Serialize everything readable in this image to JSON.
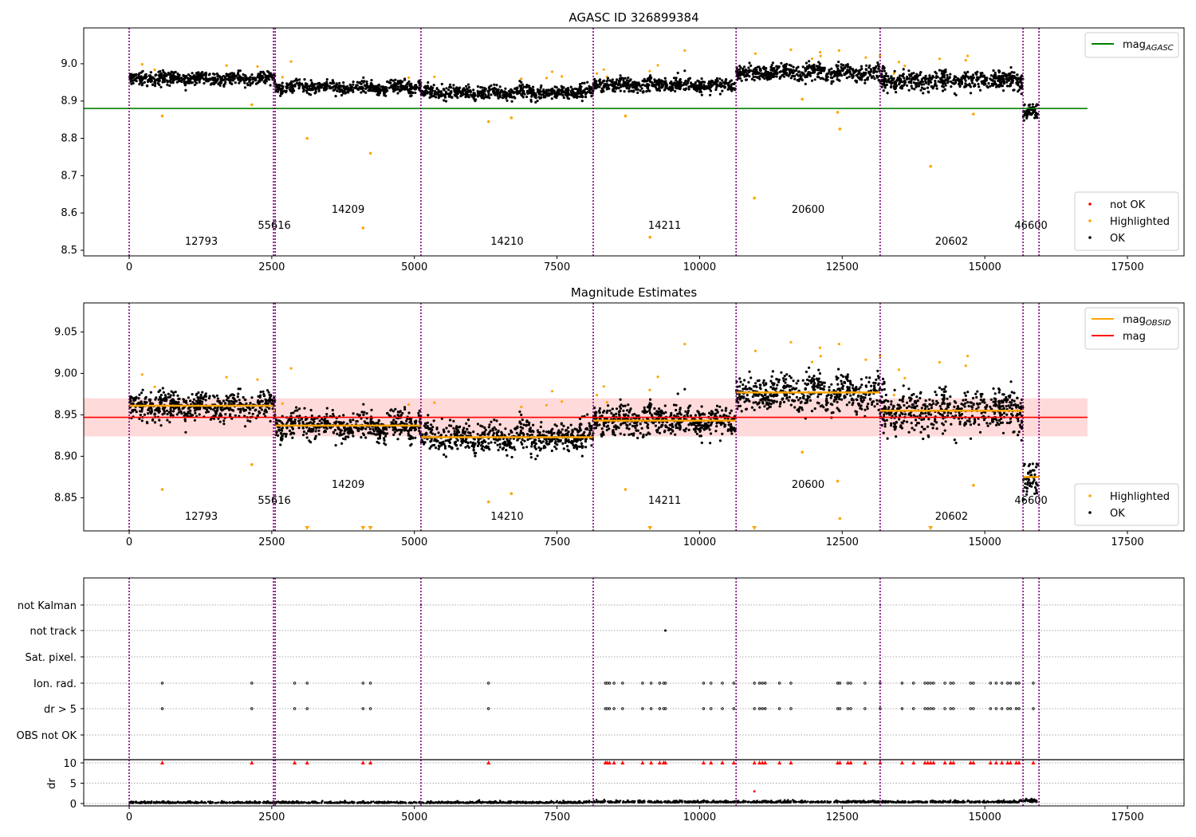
{
  "chart_data": [
    {
      "type": "scatter",
      "title": "AGASC ID 326899384",
      "xlim": [
        -800,
        18500
      ],
      "ylim": [
        8.485,
        9.096
      ],
      "xticks": [
        "0",
        "2500",
        "5000",
        "7500",
        "10000",
        "12500",
        "15000",
        "17500"
      ],
      "yticks": [
        "8.5",
        "8.6",
        "8.7",
        "8.8",
        "8.9",
        "9.0"
      ],
      "mag_agasc": 8.88,
      "legend_upper": {
        "position": "upper right",
        "entries": [
          {
            "label": "mag",
            "sub": "AGASC",
            "color": "#008000"
          }
        ]
      },
      "legend_lower": {
        "position": "lower right",
        "entries": [
          {
            "label": "not OK",
            "color": "#ff0000"
          },
          {
            "label": "Highlighted",
            "color": "#ffa500"
          },
          {
            "label": "OK",
            "color": "#000000"
          }
        ]
      },
      "highlighted": [
        [
          580,
          8.86
        ],
        [
          2150,
          8.89
        ],
        [
          3120,
          8.8
        ],
        [
          4230,
          8.76
        ],
        [
          4100,
          8.56
        ],
        [
          6300,
          8.845
        ],
        [
          6700,
          8.855
        ],
        [
          8700,
          8.86
        ],
        [
          9130,
          8.535
        ],
        [
          10960,
          8.64
        ],
        [
          11800,
          8.905
        ],
        [
          12420,
          8.87
        ],
        [
          12460,
          8.825
        ],
        [
          14050,
          8.725
        ],
        [
          14800,
          8.865
        ]
      ]
    },
    {
      "type": "scatter",
      "title": "Magnitude Estimates",
      "xlim": [
        -800,
        18500
      ],
      "ylim": [
        8.81,
        9.085
      ],
      "xticks": [
        "0",
        "2500",
        "5000",
        "7500",
        "10000",
        "12500",
        "15000",
        "17500"
      ],
      "yticks": [
        "8.85",
        "8.90",
        "8.95",
        "9.00",
        "9.05"
      ],
      "mag": 8.947,
      "mag_band": [
        8.924,
        8.97
      ],
      "legend_upper": {
        "position": "upper right",
        "entries": [
          {
            "label": "mag",
            "sub": "OBSID",
            "color": "#ffa500"
          },
          {
            "label": "mag",
            "color": "#ff0000"
          }
        ]
      },
      "legend_lower": {
        "position": "lower right",
        "entries": [
          {
            "label": "Highlighted",
            "color": "#ffa500"
          },
          {
            "label": "OK",
            "color": "#000000"
          }
        ]
      },
      "below_range": [
        3120,
        4100,
        4230,
        9130,
        10960,
        14050
      ]
    },
    {
      "type": "scatter",
      "title": "",
      "xlim": [
        -800,
        18500
      ],
      "xticks": [
        "0",
        "2500",
        "5000",
        "7500",
        "10000",
        "12500",
        "15000",
        "17500"
      ],
      "flag_labels": [
        "not Kalman",
        "not track",
        "Sat. pixel.",
        "Ion. rad.",
        "dr > 5",
        "OBS not OK"
      ],
      "ylabel": "dr",
      "dr_ticks": [
        "0",
        "5",
        "10"
      ],
      "ion_rad_times": [
        580,
        2150,
        2900,
        3120,
        4100,
        4230,
        6300,
        8350,
        8380,
        8420,
        8500,
        8650,
        9000,
        9150,
        9300,
        9370,
        9400,
        10070,
        10200,
        10400,
        10600,
        10960,
        11050,
        11100,
        11150,
        11400,
        11600,
        12420,
        12460,
        12600,
        12650,
        12900,
        13165,
        13550,
        13750,
        13950,
        14000,
        14050,
        14100,
        14300,
        14400,
        14450,
        14750,
        14800,
        15100,
        15200,
        15300,
        15400,
        15450,
        15550,
        15600,
        15850
      ],
      "not_track_times": [
        9400
      ],
      "not_kalman_times": [
        5115,
        13165,
        15670
      ]
    }
  ],
  "observations": [
    {
      "obsid": "12793",
      "start": 0,
      "end": 2530,
      "mean": 8.961,
      "std": 0.008,
      "row": 0
    },
    {
      "obsid": "55616",
      "start": 2530,
      "end": 2560,
      "mean": 8.955,
      "std": 0.008,
      "row": 1
    },
    {
      "obsid": "14209",
      "start": 2560,
      "end": 5115,
      "mean": 8.937,
      "std": 0.008,
      "row": 2
    },
    {
      "obsid": "14210",
      "start": 5115,
      "end": 8135,
      "mean": 8.923,
      "std": 0.009,
      "row": 0
    },
    {
      "obsid": "14211",
      "start": 8135,
      "end": 10640,
      "mean": 8.943,
      "std": 0.009,
      "row": 1
    },
    {
      "obsid": "20600",
      "start": 10640,
      "end": 13165,
      "mean": 8.977,
      "std": 0.011,
      "row": 2
    },
    {
      "obsid": "20602",
      "start": 13165,
      "end": 15670,
      "mean": 8.955,
      "std": 0.013,
      "row": 0
    },
    {
      "obsid": "46600",
      "start": 15670,
      "end": 15950,
      "mean": 8.875,
      "std": 0.01,
      "row": 1
    }
  ],
  "colors": {
    "ok": "#000000",
    "highlighted": "#ffa500",
    "not_ok": "#ff0000",
    "obs_boundary": "#800080",
    "agasc": "#008000",
    "mag": "#ff0000",
    "band": "#ffdada"
  }
}
